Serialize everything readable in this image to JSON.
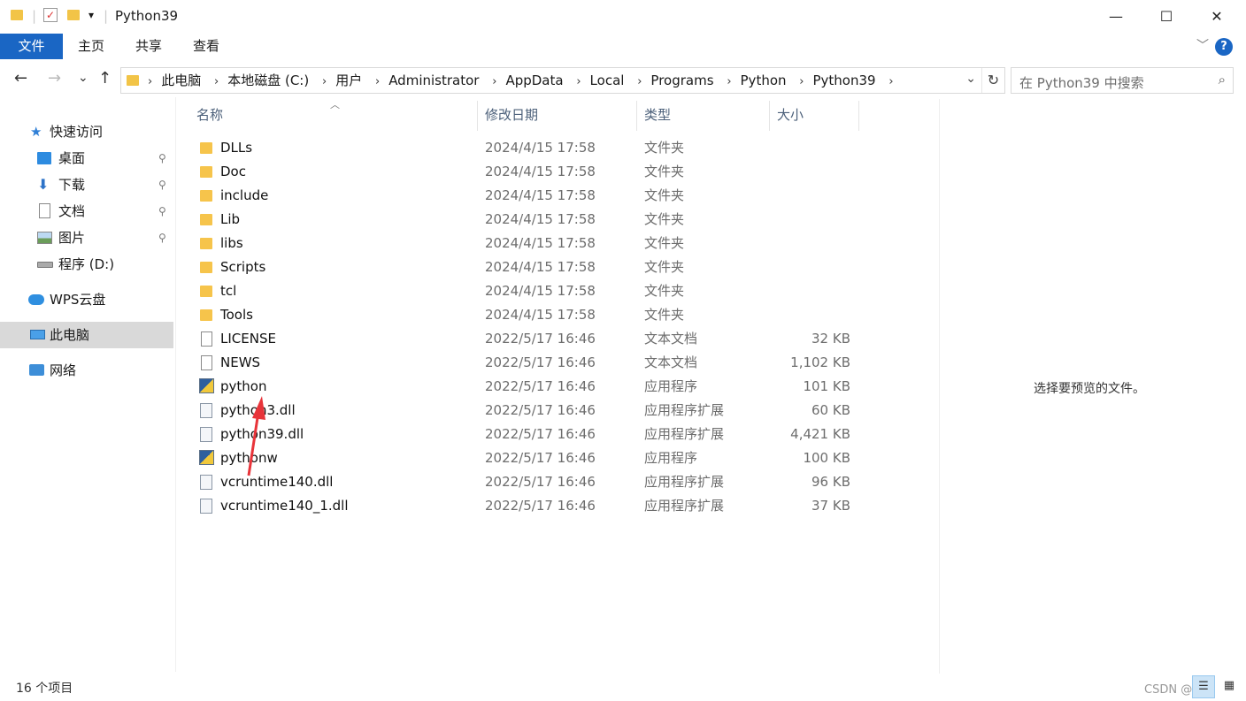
{
  "window": {
    "title": "Python39",
    "controls": {
      "minimize": "—",
      "maximize": "☐",
      "close": "✕"
    },
    "qat_dropdown": "▾"
  },
  "ribbon": {
    "tabs": [
      "文件",
      "主页",
      "共享",
      "查看"
    ],
    "help": "?",
    "expand": "﹀"
  },
  "nav": {
    "back": "←",
    "forward": "→",
    "recent": "⌄",
    "up": "↑",
    "crumbs": [
      "此电脑",
      "本地磁盘 (C:)",
      "用户",
      "Administrator",
      "AppData",
      "Local",
      "Programs",
      "Python",
      "Python39"
    ],
    "separator": "›",
    "refresh": "↻",
    "dropdown": "⌄"
  },
  "search": {
    "placeholder": "在 Python39 中搜索",
    "icon": "⌕"
  },
  "sidebar": {
    "items": [
      {
        "label": "快速访问",
        "icon": "star-icon"
      },
      {
        "label": "桌面",
        "icon": "desktop-icon",
        "pinned": true
      },
      {
        "label": "下载",
        "icon": "download-icon",
        "pinned": true
      },
      {
        "label": "文档",
        "icon": "document-icon",
        "pinned": true
      },
      {
        "label": "图片",
        "icon": "picture-icon",
        "pinned": true
      },
      {
        "label": "程序 (D:)",
        "icon": "drive-icon"
      },
      {
        "label": "WPS云盘",
        "icon": "cloud-icon"
      },
      {
        "label": "此电脑",
        "icon": "computer-icon",
        "selected": true
      },
      {
        "label": "网络",
        "icon": "network-icon"
      }
    ],
    "pin_glyph": "📌"
  },
  "columns": {
    "name": "名称",
    "date": "修改日期",
    "type": "类型",
    "size": "大小",
    "sort_glyph": "︿"
  },
  "files": [
    {
      "name": "DLLs",
      "date": "2024/4/15 17:58",
      "type": "文件夹",
      "size": "",
      "kind": "folder"
    },
    {
      "name": "Doc",
      "date": "2024/4/15 17:58",
      "type": "文件夹",
      "size": "",
      "kind": "folder"
    },
    {
      "name": "include",
      "date": "2024/4/15 17:58",
      "type": "文件夹",
      "size": "",
      "kind": "folder"
    },
    {
      "name": "Lib",
      "date": "2024/4/15 17:58",
      "type": "文件夹",
      "size": "",
      "kind": "folder"
    },
    {
      "name": "libs",
      "date": "2024/4/15 17:58",
      "type": "文件夹",
      "size": "",
      "kind": "folder"
    },
    {
      "name": "Scripts",
      "date": "2024/4/15 17:58",
      "type": "文件夹",
      "size": "",
      "kind": "folder"
    },
    {
      "name": "tcl",
      "date": "2024/4/15 17:58",
      "type": "文件夹",
      "size": "",
      "kind": "folder"
    },
    {
      "name": "Tools",
      "date": "2024/4/15 17:58",
      "type": "文件夹",
      "size": "",
      "kind": "folder"
    },
    {
      "name": "LICENSE",
      "date": "2022/5/17 16:46",
      "type": "文本文档",
      "size": "32 KB",
      "kind": "doc"
    },
    {
      "name": "NEWS",
      "date": "2022/5/17 16:46",
      "type": "文本文档",
      "size": "1,102 KB",
      "kind": "doc"
    },
    {
      "name": "python",
      "date": "2022/5/17 16:46",
      "type": "应用程序",
      "size": "101 KB",
      "kind": "exe"
    },
    {
      "name": "python3.dll",
      "date": "2022/5/17 16:46",
      "type": "应用程序扩展",
      "size": "60 KB",
      "kind": "dll"
    },
    {
      "name": "python39.dll",
      "date": "2022/5/17 16:46",
      "type": "应用程序扩展",
      "size": "4,421 KB",
      "kind": "dll"
    },
    {
      "name": "pythonw",
      "date": "2022/5/17 16:46",
      "type": "应用程序",
      "size": "100 KB",
      "kind": "exe"
    },
    {
      "name": "vcruntime140.dll",
      "date": "2022/5/17 16:46",
      "type": "应用程序扩展",
      "size": "96 KB",
      "kind": "dll"
    },
    {
      "name": "vcruntime140_1.dll",
      "date": "2022/5/17 16:46",
      "type": "应用程序扩展",
      "size": "37 KB",
      "kind": "dll"
    }
  ],
  "preview": {
    "message": "选择要预览的文件。"
  },
  "status": {
    "count": "16 个项目",
    "watermark": "CSDN @乐玖"
  },
  "view_buttons": {
    "details": "☰",
    "tiles": "▦"
  },
  "colors": {
    "accent": "#1a66c4",
    "folder": "#f6c44b",
    "selected_nav": "#d9d9d9",
    "annotation": "#e8343a"
  }
}
